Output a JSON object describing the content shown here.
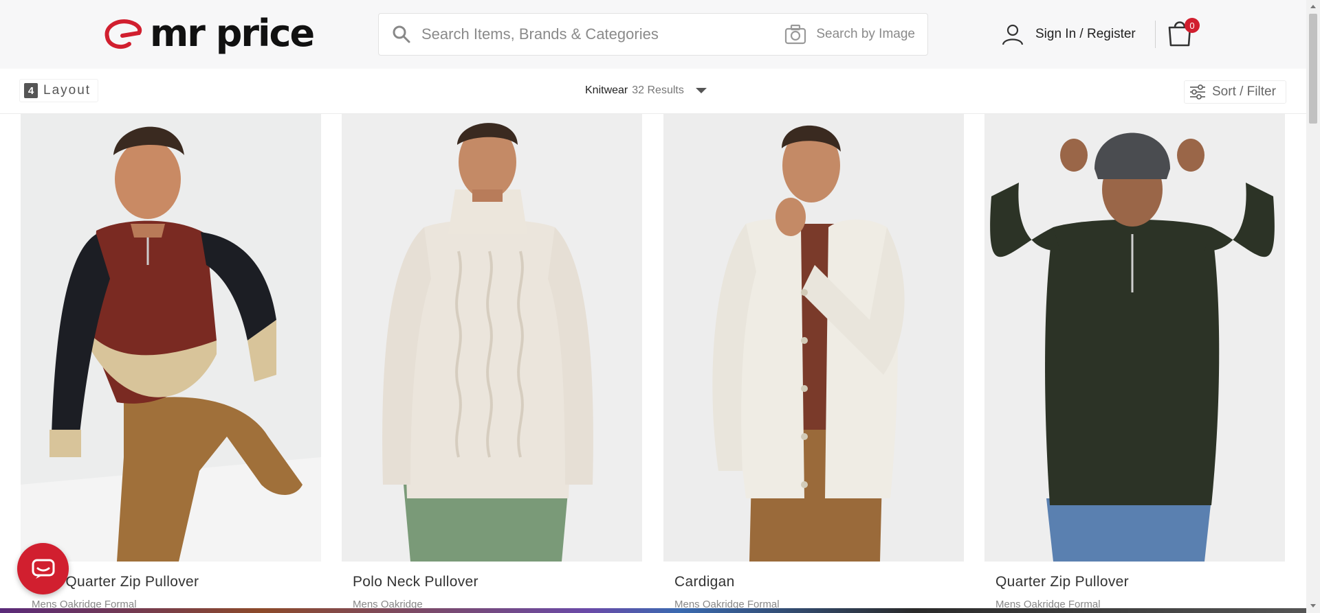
{
  "header": {
    "logo_text": "mr price",
    "search_placeholder": "Search Items, Brands & Categories",
    "search_by_image_label": "Search by Image",
    "account_label": "Sign In / Register",
    "cart_count": "0"
  },
  "toolbar": {
    "layout_number": "4",
    "layout_label": "Layout",
    "category": "Knitwear",
    "results": "32 Results",
    "sort_filter_label": "Sort / Filter"
  },
  "products": [
    {
      "title": "Textured Quarter Zip Pullover",
      "visible_title": "ured Quarter Zip Pullover",
      "brand": "Mens Oakridge Formal"
    },
    {
      "title": "Polo Neck Pullover",
      "visible_title": "Polo Neck Pullover",
      "brand": "Mens Oakridge"
    },
    {
      "title": "Cardigan",
      "visible_title": "Cardigan",
      "brand": "Mens Oakridge Formal"
    },
    {
      "title": "Quarter Zip Pullover",
      "visible_title": "Quarter Zip Pullover",
      "brand": "Mens Oakridge Formal"
    }
  ],
  "colors": {
    "brand_red": "#d11f2f",
    "header_bg": "#f7f7f8"
  }
}
